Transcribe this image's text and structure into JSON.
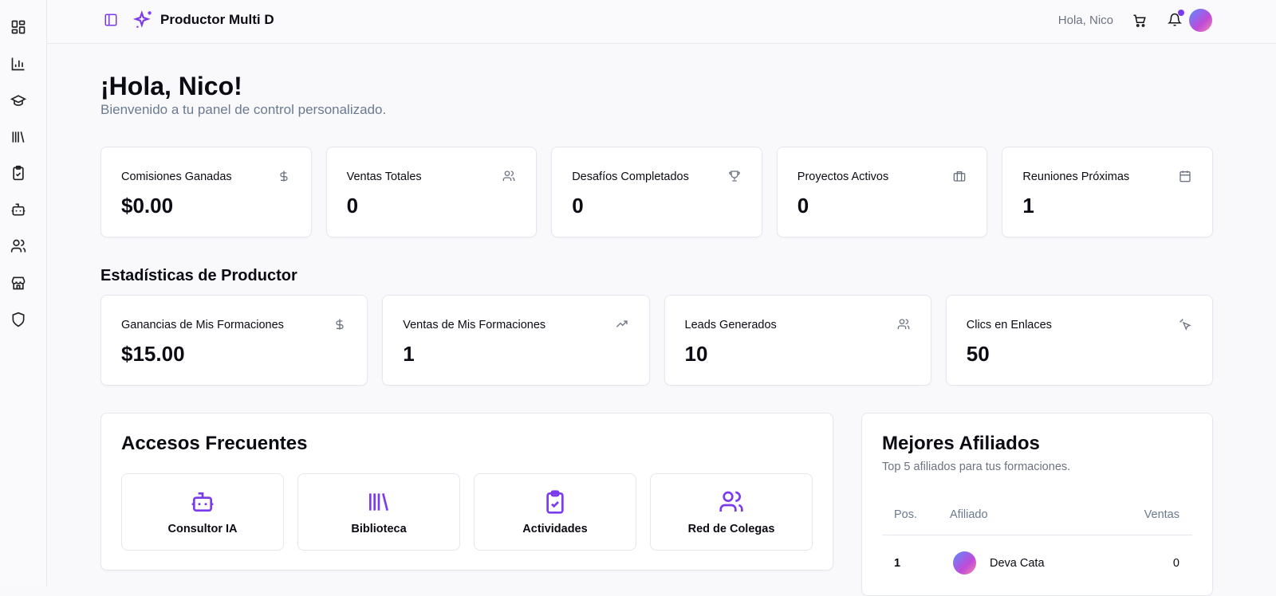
{
  "sidebar": {
    "items": [
      "dashboard",
      "statistics",
      "courses",
      "library",
      "activities",
      "ai-consultant",
      "colleagues",
      "store",
      "security"
    ]
  },
  "header": {
    "app_title": "Productor Multi D",
    "greeting": "Hola, Nico",
    "accent": "#7c3aed"
  },
  "welcome": {
    "title": "¡Hola, Nico!",
    "subtitle": "Bienvenido a tu panel de control personalizado."
  },
  "stats": [
    {
      "label": "Comisiones Ganadas",
      "value": "$0.00",
      "icon": "dollar-icon"
    },
    {
      "label": "Ventas Totales",
      "value": "0",
      "icon": "users-icon"
    },
    {
      "label": "Desafíos Completados",
      "value": "0",
      "icon": "trophy-icon"
    },
    {
      "label": "Proyectos Activos",
      "value": "0",
      "icon": "briefcase-icon"
    },
    {
      "label": "Reuniones Próximas",
      "value": "1",
      "icon": "calendar-icon"
    }
  ],
  "producer": {
    "title": "Estadísticas de Productor",
    "stats": [
      {
        "label": "Ganancias de Mis Formaciones",
        "value": "$15.00",
        "icon": "dollar-icon"
      },
      {
        "label": "Ventas de Mis Formaciones",
        "value": "1",
        "icon": "trending-up-icon"
      },
      {
        "label": "Leads Generados",
        "value": "10",
        "icon": "users-icon"
      },
      {
        "label": "Clics en Enlaces",
        "value": "50",
        "icon": "pointer-click-icon"
      }
    ]
  },
  "quick": {
    "title": "Accesos Frecuentes",
    "items": [
      {
        "label": "Consultor IA"
      },
      {
        "label": "Biblioteca"
      },
      {
        "label": "Actividades"
      },
      {
        "label": "Red de Colegas"
      }
    ]
  },
  "affiliates": {
    "title": "Mejores Afiliados",
    "subtitle": "Top 5 afiliados para tus formaciones.",
    "columns": [
      "Pos.",
      "Afiliado",
      "Ventas"
    ],
    "rows": [
      {
        "pos": "1",
        "name": "Deva Cata",
        "sales": "0"
      }
    ]
  }
}
